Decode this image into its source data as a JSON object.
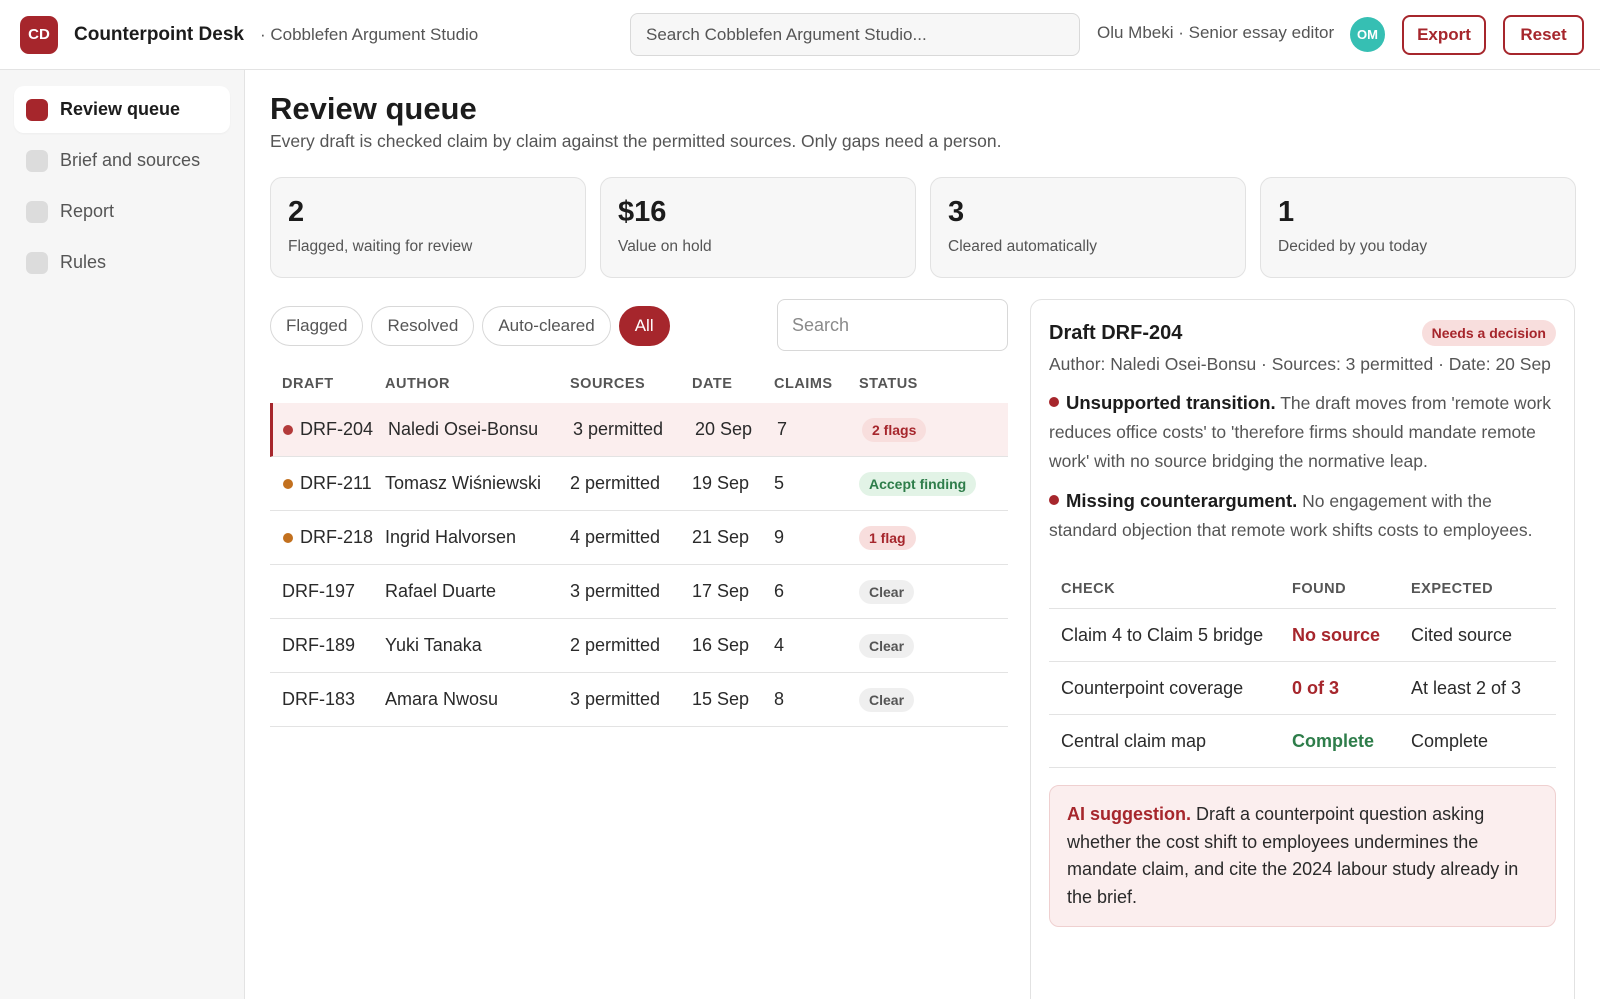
{
  "app": {
    "logo": "CD",
    "title": "Counterpoint Desk",
    "workspace": "· Cobblefen Argument Studio",
    "search_placeholder": "Search Cobblefen Argument Studio...",
    "user": "Olu Mbeki · Senior essay editor",
    "avatar": "OM",
    "export_label": "Export",
    "reset_label": "Reset"
  },
  "sidebar": {
    "items": [
      {
        "label": "Review queue",
        "active": true
      },
      {
        "label": "Brief and sources",
        "active": false
      },
      {
        "label": "Report",
        "active": false
      },
      {
        "label": "Rules",
        "active": false
      }
    ]
  },
  "main": {
    "title": "Review queue",
    "subtitle": "Every draft is checked claim by claim against the permitted sources. Only gaps need a person.",
    "stats": [
      {
        "value": "2",
        "label": "Flagged, waiting for review"
      },
      {
        "value": "$16",
        "label": "Value on hold"
      },
      {
        "value": "3",
        "label": "Cleared automatically"
      },
      {
        "value": "1",
        "label": "Decided by you today"
      }
    ],
    "filters": [
      "Flagged",
      "Resolved",
      "Auto-cleared",
      "All"
    ],
    "active_filter": "All",
    "search_placeholder": "Search"
  },
  "table": {
    "headers": [
      "DRAFT",
      "AUTHOR",
      "SOURCES",
      "DATE",
      "CLAIMS",
      "STATUS"
    ],
    "rows": [
      {
        "draft": "DRF-204",
        "author": "Naledi Osei-Bonsu",
        "sources": "3 permitted",
        "date": "20 Sep",
        "claims": "7",
        "status": "2 flags",
        "status_tone": "red",
        "dot": "#b33a3a",
        "selected": true
      },
      {
        "draft": "DRF-211",
        "author": "Tomasz Wiśniewski",
        "sources": "2 permitted",
        "date": "19 Sep",
        "claims": "5",
        "status": "Accept finding",
        "status_tone": "green",
        "dot": "#c2701e",
        "selected": false
      },
      {
        "draft": "DRF-218",
        "author": "Ingrid Halvorsen",
        "sources": "4 permitted",
        "date": "21 Sep",
        "claims": "9",
        "status": "1 flag",
        "status_tone": "red",
        "dot": "#c2701e",
        "selected": false
      },
      {
        "draft": "DRF-197",
        "author": "Rafael Duarte",
        "sources": "3 permitted",
        "date": "17 Sep",
        "claims": "6",
        "status": "Clear",
        "status_tone": "gray",
        "dot": null,
        "selected": false
      },
      {
        "draft": "DRF-189",
        "author": "Yuki Tanaka",
        "sources": "2 permitted",
        "date": "16 Sep",
        "claims": "4",
        "status": "Clear",
        "status_tone": "gray",
        "dot": null,
        "selected": false
      },
      {
        "draft": "DRF-183",
        "author": "Amara Nwosu",
        "sources": "3 permitted",
        "date": "15 Sep",
        "claims": "8",
        "status": "Clear",
        "status_tone": "gray",
        "dot": null,
        "selected": false
      }
    ]
  },
  "detail": {
    "title": "Draft DRF-204",
    "badge": "Needs a decision",
    "meta": "Author: Naledi Osei-Bonsu · Sources: 3 permitted · Date: 20 Sep",
    "findings": [
      {
        "title": "Unsupported transition.",
        "text": "The draft moves from 'remote work reduces office costs' to 'therefore firms should mandate remote work' with no source bridging the normative leap."
      },
      {
        "title": "Missing counterargument.",
        "text": "No engagement with the standard objection that remote work shifts costs to employees."
      }
    ],
    "checks_headers": [
      "CHECK",
      "FOUND",
      "EXPECTED"
    ],
    "checks": [
      {
        "check": "Claim 4 to Claim 5 bridge",
        "found": "No source",
        "found_tone": "red",
        "expected": "Cited source"
      },
      {
        "check": "Counterpoint coverage",
        "found": "0 of 3",
        "found_tone": "red",
        "expected": "At least 2 of 3"
      },
      {
        "check": "Central claim map",
        "found": "Complete",
        "found_tone": "green",
        "expected": "Complete"
      }
    ],
    "ai_label": "AI suggestion.",
    "ai_text": "Draft a counterpoint question asking whether the cost shift to employees undermines the mandate claim, and cite the 2024 labour study already in the brief."
  },
  "colors": {
    "accent": "#a6262c",
    "avatar": "#36bfb3",
    "success": "#2e7d4a",
    "warning_dot": "#c2701e"
  }
}
